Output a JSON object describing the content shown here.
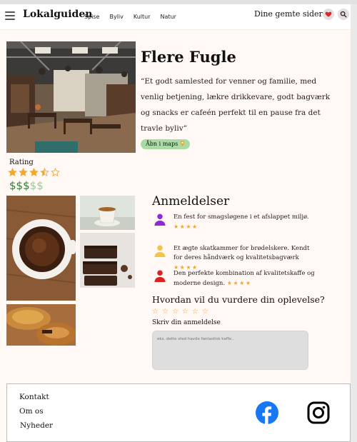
{
  "header": {
    "logo": "Lokalguiden",
    "nav": [
      "Spise",
      "Byliv",
      "Kultur",
      "Natur"
    ],
    "saved_label": "Dine gemte sider"
  },
  "place": {
    "title": "Flere Fugle",
    "description": "“Et godt samlested for venner og familie, med venlig betjening, lækre drikkevare, godt bagværk og snacks er cafeén perfekt til en pause fra det travle byliv”",
    "maps_label": "Åbn i maps"
  },
  "rating": {
    "label": "Rating",
    "value": 3.5,
    "max": 5,
    "price_level": 3,
    "price_max": 5,
    "price_symbol": "$"
  },
  "reviews": {
    "title": "Anmeldelser",
    "items": [
      {
        "text": "En fest for smagsløgene i et afslappet miljø.",
        "stars": 4,
        "avatar_color": "#8e2bd1"
      },
      {
        "text": "Et ægte skatkammer for brødelskere. Kendt for deres håndværk og kvalitetsbagværk",
        "stars": 4,
        "avatar_color": "#f3c44a"
      },
      {
        "text": "Den perfekte kombination af kvalitetskaffe og moderne design.",
        "stars": 4,
        "avatar_color": "#d92323"
      }
    ]
  },
  "rate_form": {
    "question": "Hvordan vil du vurdere din oplevelse?",
    "stars": 6,
    "write_label": "Skriv din anmeldelse",
    "placeholder": "eks. dette sted havde fantastisk kaffe.."
  },
  "footer": {
    "links": [
      "Kontakt",
      "Om os",
      "Nyheder"
    ]
  },
  "colors": {
    "accent_green": "#a8dca4",
    "star": "#f2a62c",
    "heart": "#e0242c",
    "facebook": "#1877f2"
  }
}
